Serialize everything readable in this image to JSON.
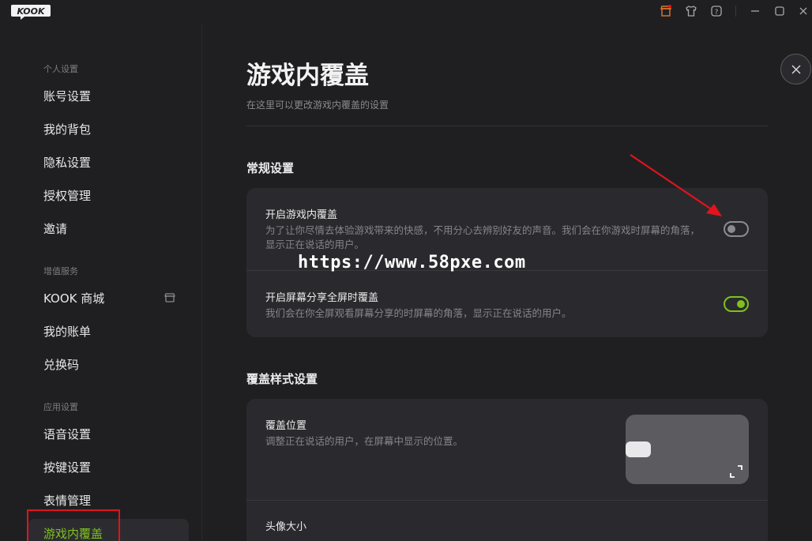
{
  "app": {
    "logo_text": "KOOK"
  },
  "titlebar": {
    "icons": [
      "store-icon",
      "shirt-icon",
      "help-icon",
      "minimize-icon",
      "maximize-icon",
      "close-window-icon"
    ]
  },
  "sidebar": {
    "sections": [
      {
        "label": "个人设置",
        "items": [
          "账号设置",
          "我的背包",
          "隐私设置",
          "授权管理",
          "邀请"
        ]
      },
      {
        "label": "增值服务",
        "items": [
          "KOOK 商城",
          "我的账单",
          "兑换码"
        ]
      },
      {
        "label": "应用设置",
        "items": [
          "语音设置",
          "按键设置",
          "表情管理",
          "游戏内覆盖"
        ]
      }
    ],
    "active_item": "游戏内覆盖"
  },
  "main": {
    "title": "游戏内覆盖",
    "subtitle": "在这里可以更改游戏内覆盖的设置",
    "general": {
      "title": "常规设置",
      "rows": [
        {
          "title": "开启游戏内覆盖",
          "desc": "为了让你尽情去体验游戏带来的快感，不用分心去辨别好友的声音。我们会在你游戏时屏幕的角落，显示正在说话的用户。",
          "enabled": false
        },
        {
          "title": "开启屏幕分享全屏时覆盖",
          "desc": "我们会在你全屏观看屏幕分享的时屏幕的角落，显示正在说话的用户。",
          "enabled": true
        }
      ]
    },
    "style": {
      "title": "覆盖样式设置",
      "rows": [
        {
          "title": "覆盖位置",
          "desc": "调整正在说话的用户，在屏幕中显示的位置。"
        },
        {
          "title": "头像大小"
        }
      ]
    }
  },
  "watermark": "https://www.58pxe.com",
  "colors": {
    "accent": "#7ec11d",
    "highlight": "#e0141d",
    "background": "#1f1f22",
    "card": "#2a2a2e"
  }
}
